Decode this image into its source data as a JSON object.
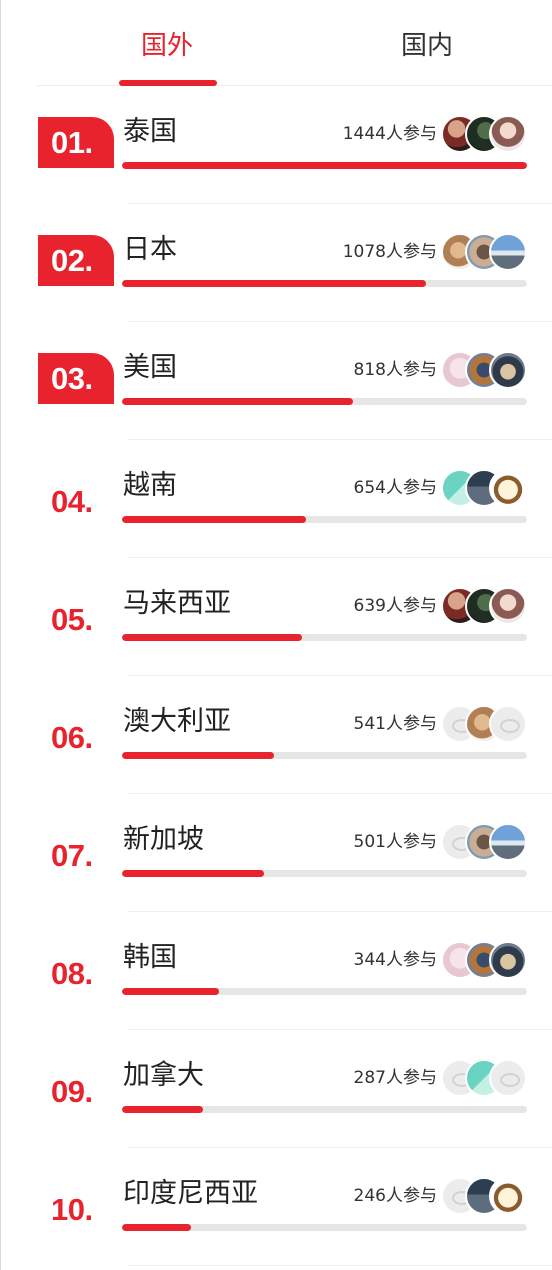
{
  "tabs": [
    {
      "label": "国外",
      "active": true
    },
    {
      "label": "国内",
      "active": false
    }
  ],
  "colors": {
    "accent": "#e8232d",
    "track": "#e6e6e6"
  },
  "rows": [
    {
      "rank": "01.",
      "name": "泰国",
      "count": "1444人参与",
      "progress": 1.0,
      "avatars": [
        "photo",
        "photo",
        "photo"
      ]
    },
    {
      "rank": "02.",
      "name": "日本",
      "count": "1078人参与",
      "progress": 0.75,
      "avatars": [
        "photo",
        "photo",
        "photo"
      ]
    },
    {
      "rank": "03.",
      "name": "美国",
      "count": "818人参与",
      "progress": 0.57,
      "avatars": [
        "photo",
        "photo",
        "photo"
      ]
    },
    {
      "rank": "04.",
      "name": "越南",
      "count": "654人参与",
      "progress": 0.455,
      "avatars": [
        "photo",
        "photo",
        "photo"
      ]
    },
    {
      "rank": "05.",
      "name": "马来西亚",
      "count": "639人参与",
      "progress": 0.445,
      "avatars": [
        "photo",
        "photo",
        "photo"
      ]
    },
    {
      "rank": "06.",
      "name": "澳大利亚",
      "count": "541人参与",
      "progress": 0.375,
      "avatars": [
        "placeholder",
        "photo",
        "placeholder"
      ]
    },
    {
      "rank": "07.",
      "name": "新加坡",
      "count": "501人参与",
      "progress": 0.35,
      "avatars": [
        "placeholder",
        "photo",
        "photo"
      ]
    },
    {
      "rank": "08.",
      "name": "韩国",
      "count": "344人参与",
      "progress": 0.24,
      "avatars": [
        "photo",
        "photo",
        "photo"
      ]
    },
    {
      "rank": "09.",
      "name": "加拿大",
      "count": "287人参与",
      "progress": 0.2,
      "avatars": [
        "placeholder",
        "photo",
        "placeholder"
      ]
    },
    {
      "rank": "10.",
      "name": "印度尼西亚",
      "count": "246人参与",
      "progress": 0.17,
      "avatars": [
        "placeholder",
        "photo",
        "photo"
      ]
    }
  ]
}
